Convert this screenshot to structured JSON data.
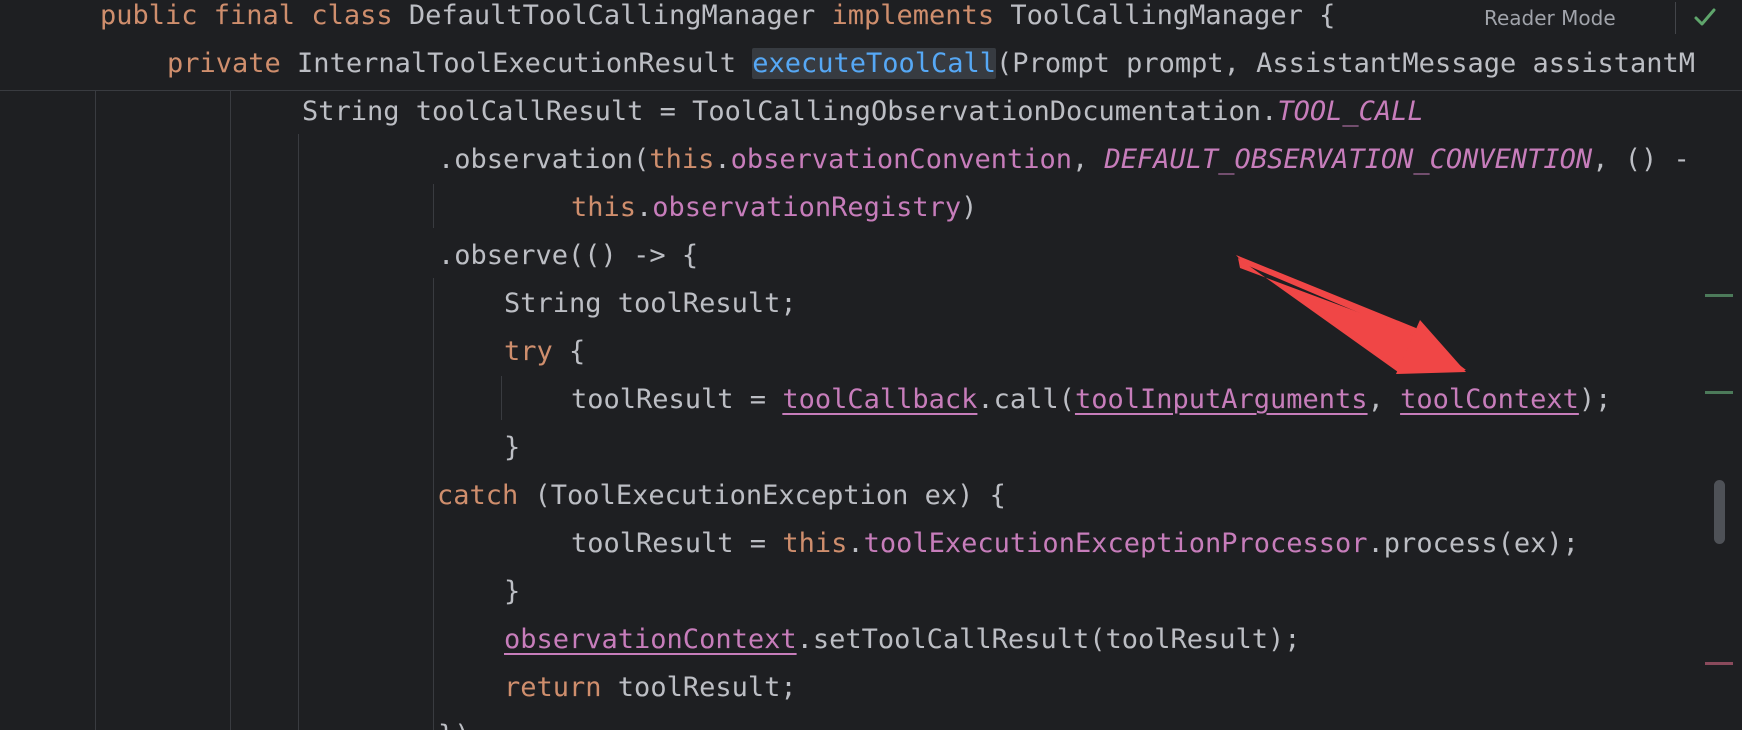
{
  "editor": {
    "header": {
      "class_line": {
        "kw1": "public final class",
        "name": " DefaultToolCallingManager ",
        "kw2": "implements",
        "iface": " ToolCallingManager {"
      },
      "method_line": {
        "kw": "private",
        "ret": " InternalToolExecutionResult ",
        "method": "executeToolCall",
        "params": "(Prompt prompt, AssistantMessage assistantM"
      },
      "reader_mode_label": "Reader Mode",
      "status_icon": "checkmark-icon"
    },
    "lines": {
      "l1": {
        "a": "String toolCallResult = ToolCallingObservationDocumentation.",
        "b": "TOOL_CALL"
      },
      "l2": {
        "a": ".observation(",
        "b": "this",
        "c": ".",
        "d": "observationConvention",
        "e": ", ",
        "f": "DEFAULT_OBSERVATION_CONVENTION",
        "g": ", () -"
      },
      "l3": {
        "a": "this",
        "b": ".",
        "c": "observationRegistry",
        "d": ")"
      },
      "l4": {
        "a": ".observe(() -> {"
      },
      "l5": {
        "a": "String toolResult;"
      },
      "l6": {
        "a": "try",
        "b": " {"
      },
      "l7": {
        "a": "toolResult = ",
        "b": "toolCallback",
        "c": ".call(",
        "d": "toolInputArguments",
        "e": ", ",
        "f": "toolContext",
        "g": ");"
      },
      "l8": {
        "a": "}"
      },
      "l9": {
        "a": "catch",
        "b": " (ToolExecutionException ex) {"
      },
      "l10": {
        "a": "toolResult = ",
        "b": "this",
        "c": ".",
        "d": "toolExecutionExceptionProcessor",
        "e": ".process(ex);"
      },
      "l11": {
        "a": "}"
      },
      "l12": {
        "a": "observationContext",
        "b": ".setToolCallResult(toolResult);"
      },
      "l13": {
        "a": "return",
        "b": " toolResult;"
      },
      "l14": {
        "a": "})"
      }
    },
    "annotation": {
      "type": "arrow",
      "color": "#f04646",
      "points_to": "toolContext"
    },
    "colors": {
      "background": "#1e1f22",
      "keyword": "#cf8e6d",
      "field": "#c77dbb",
      "method_highlight": "#56a8f5",
      "text": "#bcbec4",
      "change_marker_added": "#4c7a5a",
      "change_marker_modified": "#8a4a5c"
    }
  }
}
